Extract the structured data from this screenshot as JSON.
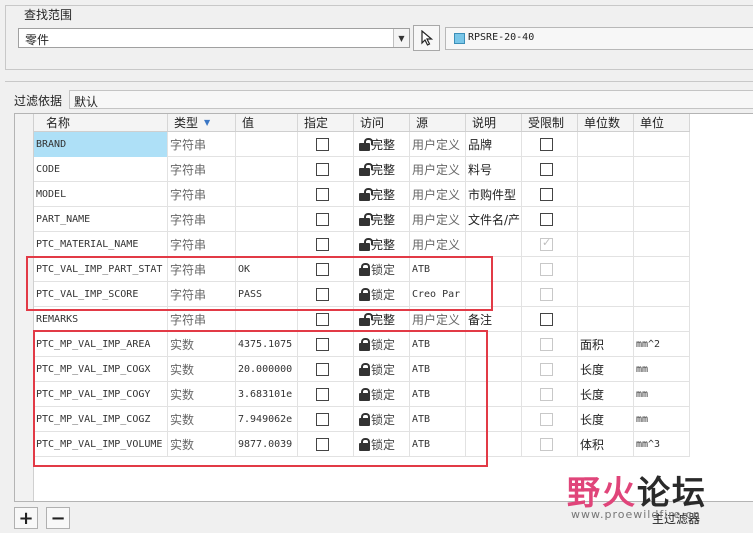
{
  "search_scope": {
    "legend": "查找范围",
    "type_combo_value": "零件",
    "model_name": "RPSRE-20-40"
  },
  "filter": {
    "label": "过滤依据",
    "value": "默认"
  },
  "columns": [
    "名称",
    "类型",
    "值",
    "指定",
    "访问",
    "源",
    "说明",
    "受限制",
    "单位数",
    "单位"
  ],
  "rows": [
    {
      "name": "BRAND",
      "type": "字符串",
      "value": "",
      "designate": "box",
      "access_lock": "open",
      "access": "完整",
      "source": "用户定义",
      "desc": "品牌",
      "restricted": "box",
      "unit_type": "",
      "unit": "",
      "selected": true
    },
    {
      "name": "CODE",
      "type": "字符串",
      "value": "",
      "designate": "box",
      "access_lock": "open",
      "access": "完整",
      "source": "用户定义",
      "desc": "料号",
      "restricted": "box",
      "unit_type": "",
      "unit": "",
      "selected": false
    },
    {
      "name": "MODEL",
      "type": "字符串",
      "value": "",
      "designate": "box",
      "access_lock": "open",
      "access": "完整",
      "source": "用户定义",
      "desc": "市购件型",
      "restricted": "box",
      "unit_type": "",
      "unit": "",
      "selected": false
    },
    {
      "name": "PART_NAME",
      "type": "字符串",
      "value": "",
      "designate": "box",
      "access_lock": "open",
      "access": "完整",
      "source": "用户定义",
      "desc": "文件名/产",
      "restricted": "box",
      "unit_type": "",
      "unit": "",
      "selected": false
    },
    {
      "name": "PTC_MATERIAL_NAME",
      "type": "字符串",
      "value": "",
      "designate": "box",
      "access_lock": "open",
      "access": "完整",
      "source": "用户定义",
      "desc": "",
      "restricted": "checked-dim",
      "unit_type": "",
      "unit": "",
      "selected": false
    },
    {
      "name": "PTC_VAL_IMP_PART_STAT",
      "type": "字符串",
      "value": "OK",
      "designate": "box",
      "access_lock": "closed",
      "access": "锁定",
      "source": "ATB",
      "desc": "",
      "restricted": "dim",
      "unit_type": "",
      "unit": "",
      "selected": false
    },
    {
      "name": "PTC_VAL_IMP_SCORE",
      "type": "字符串",
      "value": "PASS",
      "designate": "box",
      "access_lock": "closed",
      "access": "锁定",
      "source": "Creo Par",
      "desc": "",
      "restricted": "dim",
      "unit_type": "",
      "unit": "",
      "selected": false
    },
    {
      "name": "REMARKS",
      "type": "字符串",
      "value": "",
      "designate": "box",
      "access_lock": "open",
      "access": "完整",
      "source": "用户定义",
      "desc": "备注",
      "restricted": "box",
      "unit_type": "",
      "unit": "",
      "selected": false
    },
    {
      "name": "PTC_MP_VAL_IMP_AREA",
      "type": "实数",
      "value": "4375.1075",
      "designate": "box",
      "access_lock": "closed",
      "access": "锁定",
      "source": "ATB",
      "desc": "",
      "restricted": "dim",
      "unit_type": "面积",
      "unit": "mm^2",
      "selected": false
    },
    {
      "name": "PTC_MP_VAL_IMP_COGX",
      "type": "实数",
      "value": "20.000000",
      "designate": "box",
      "access_lock": "closed",
      "access": "锁定",
      "source": "ATB",
      "desc": "",
      "restricted": "dim",
      "unit_type": "长度",
      "unit": "mm",
      "selected": false
    },
    {
      "name": "PTC_MP_VAL_IMP_COGY",
      "type": "实数",
      "value": "3.683101e",
      "designate": "box",
      "access_lock": "closed",
      "access": "锁定",
      "source": "ATB",
      "desc": "",
      "restricted": "dim",
      "unit_type": "长度",
      "unit": "mm",
      "selected": false
    },
    {
      "name": "PTC_MP_VAL_IMP_COGZ",
      "type": "实数",
      "value": "7.949062e",
      "designate": "box",
      "access_lock": "closed",
      "access": "锁定",
      "source": "ATB",
      "desc": "",
      "restricted": "dim",
      "unit_type": "长度",
      "unit": "mm",
      "selected": false
    },
    {
      "name": "PTC_MP_VAL_IMP_VOLUME",
      "type": "实数",
      "value": "9877.0039",
      "designate": "box",
      "access_lock": "closed",
      "access": "锁定",
      "source": "ATB",
      "desc": "",
      "restricted": "dim",
      "unit_type": "体积",
      "unit": "mm^3",
      "selected": false
    }
  ],
  "bottom": {
    "add_label": "+",
    "remove_label": "−",
    "right_label": "主过滤器"
  },
  "watermark": {
    "title_a": "野火",
    "title_b": "论坛",
    "url": "www.proewildfire.cn"
  },
  "colors": {
    "highlight_box": "#e23a46",
    "selection": "#aee0f7"
  }
}
